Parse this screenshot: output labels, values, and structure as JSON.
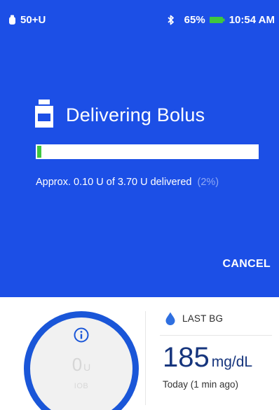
{
  "status_bar": {
    "pod_reservoir": "50+U",
    "battery_percent": "65%",
    "time": "10:54 AM",
    "icons": [
      "pod-icon",
      "bluetooth-icon",
      "battery-icon"
    ],
    "battery_color": "#3fc63f"
  },
  "bolus": {
    "title": "Delivering Bolus",
    "progress_fraction": 0.02,
    "progress_text": "Approx. 0.10 U of 3.70 U delivered",
    "progress_percent": "(2%)",
    "cancel_label": "CANCEL",
    "icon": "insulin-bottle-icon"
  },
  "iob": {
    "value": "0",
    "unit": "U",
    "label": "IOB",
    "icon": "info-icon"
  },
  "last_bg": {
    "label": "LAST BG",
    "value": "185",
    "unit": "mg/dL",
    "time": "Today (1 min ago)",
    "icon": "blood-drop-icon"
  },
  "colors": {
    "overlay_blue": "#1c4fe6",
    "ring_blue": "#1a56d8",
    "progress_green": "#3fc63f",
    "bg_value_navy": "#16357d",
    "drop_blue": "#2f6fe0"
  }
}
